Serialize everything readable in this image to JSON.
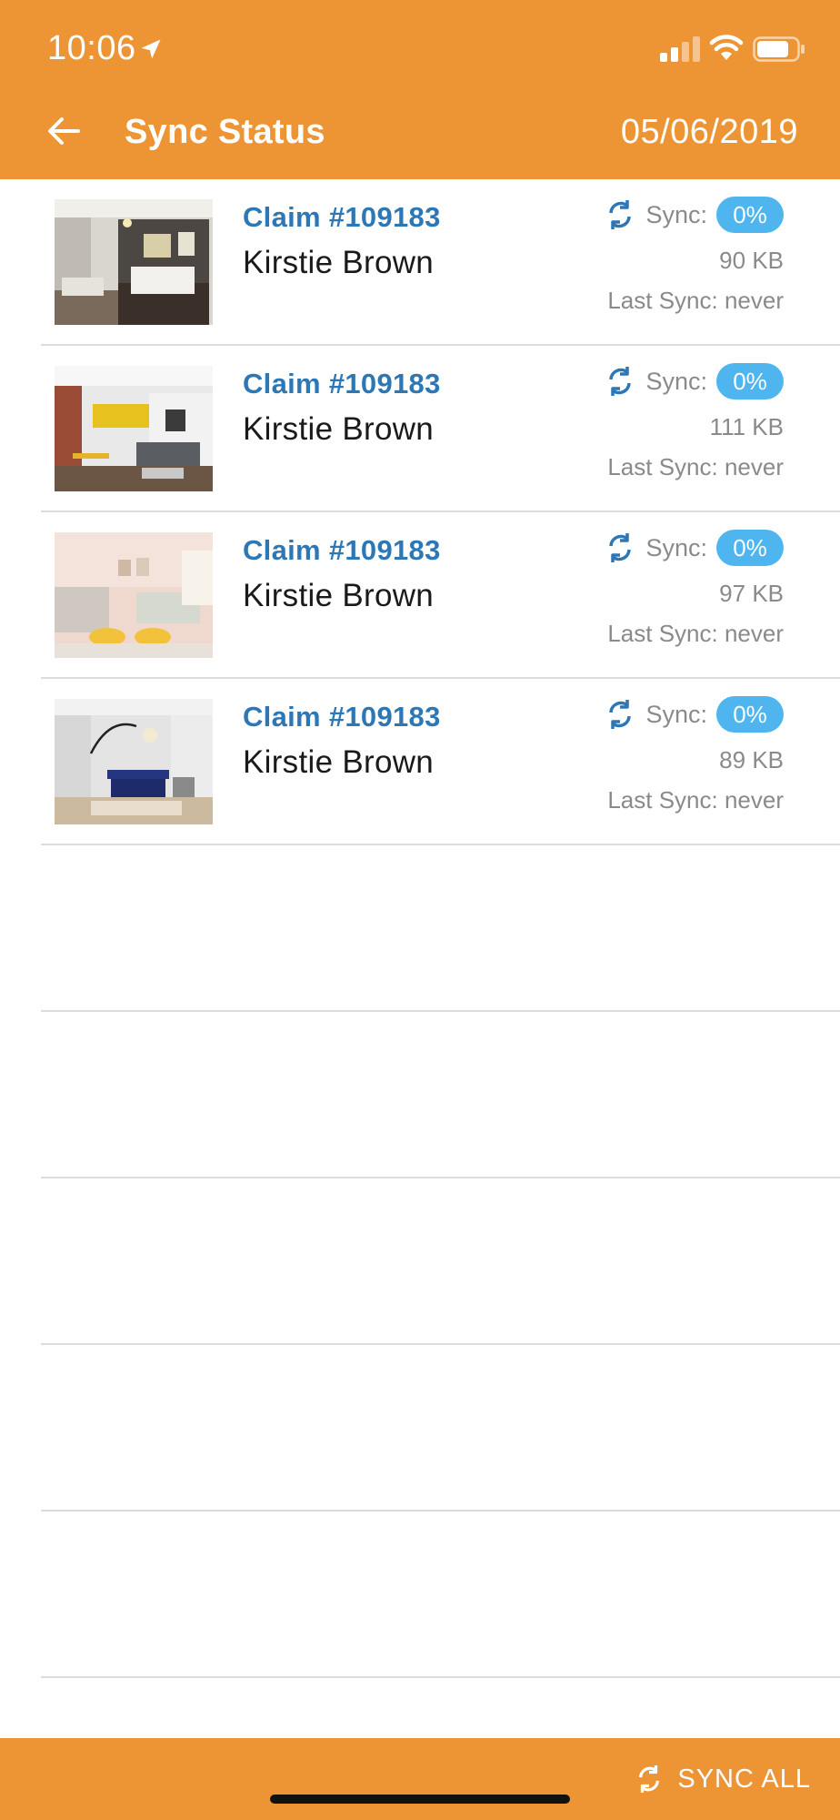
{
  "status_bar": {
    "time": "10:06"
  },
  "header": {
    "title": "Sync Status",
    "date": "05/06/2019"
  },
  "claims": [
    {
      "claim": "Claim #109183",
      "name": "Kirstie Brown",
      "sync_label": "Sync:",
      "progress": "0%",
      "size": "90 KB",
      "last_sync": "Last Sync: never"
    },
    {
      "claim": "Claim #109183",
      "name": "Kirstie Brown",
      "sync_label": "Sync:",
      "progress": "0%",
      "size": "111 KB",
      "last_sync": "Last Sync: never"
    },
    {
      "claim": "Claim #109183",
      "name": "Kirstie Brown",
      "sync_label": "Sync:",
      "progress": "0%",
      "size": "97 KB",
      "last_sync": "Last Sync: never"
    },
    {
      "claim": "Claim #109183",
      "name": "Kirstie Brown",
      "sync_label": "Sync:",
      "progress": "0%",
      "size": "89 KB",
      "last_sync": "Last Sync: never"
    }
  ],
  "footer": {
    "sync_all_label": "SYNC ALL"
  },
  "colors": {
    "header_bg": "#ED9435",
    "claim_text": "#2E77B5",
    "badge_bg": "#4FB5EE",
    "divider": "#dcdcdc"
  },
  "icons": {
    "back": "arrow-left-icon",
    "sync": "sync-icon",
    "location": "location-arrow-icon",
    "signal": "signal-icon",
    "wifi": "wifi-icon",
    "battery": "battery-icon"
  }
}
